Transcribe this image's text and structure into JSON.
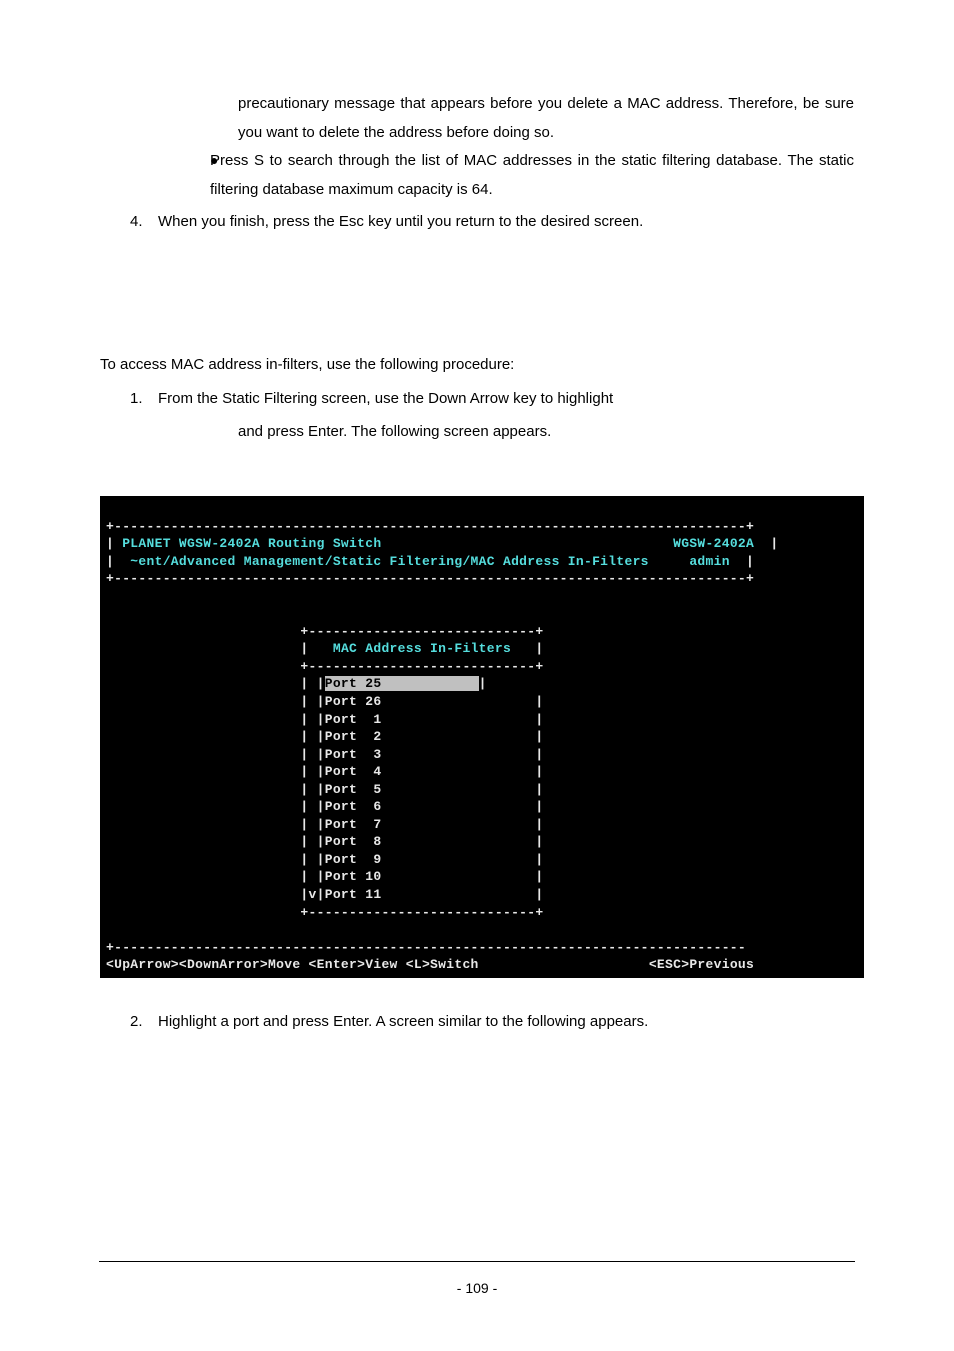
{
  "para_continue1": "precautionary message that appears before you delete a MAC address. Therefore, be sure you want to delete the address before doing so.",
  "bullet_s": "Press S to search through the list of MAC addresses in the static filtering database. The static filtering database maximum capacity is 64.",
  "step4_num": "4.",
  "step4_text": "When you finish, press the Esc key until you return to the desired screen.",
  "access_para": "To access MAC address in-filters, use the following procedure:",
  "step1_num": "1.",
  "step1_text": "From the Static Filtering screen, use the Down Arrow key to highlight ",
  "step1_cont": " and press Enter. The following screen appears.",
  "terminal": {
    "rule_top": "+------------------------------------------------------------------------------+",
    "title_line1_pre": "| ",
    "title_line1_left": "PLANET WGSW-2402A Routing Switch",
    "title_line1_gap": "                                    ",
    "title_line1_right": "WGSW-2402A",
    "title_line1_post": "  |",
    "title_line2_pre": "| ",
    "title_line2_left": " ~ent/Advanced Management/Static Filtering/MAC Address In-Filters",
    "title_line2_gap": "     ",
    "title_line2_right": "admin",
    "title_line2_post": "  |",
    "rule_mid": "+------------------------------------------------------------------------------+",
    "blank": "",
    "box_top": "                        +----------------------------+",
    "box_title_pre": "                        |   ",
    "box_title": "MAC Address In-Filters",
    "box_title_post": "   |",
    "box_sep": "                        +----------------------------+",
    "row_prefix": "                        | |",
    "row_suffix_pad": "                   |",
    "rows": [
      "Port 25",
      "Port 26",
      "Port  1",
      "Port  2",
      "Port  3",
      "Port  4",
      "Port  5",
      "Port  6",
      "Port  7",
      "Port  8",
      "Port  9",
      "Port 10"
    ],
    "row_scroll_pre": "                        |v|",
    "row_scroll": "Port 11",
    "box_bot": "                        +----------------------------+",
    "rule_bot": "+------------------------------------------------------------------------------",
    "help_left": "<UpArrow><DownArror>Move <Enter>View <L>Switch",
    "help_gap": "                     ",
    "help_right": "<ESC>Previous"
  },
  "step2_num": "2.",
  "step2_text": "Highlight a port and press Enter. A screen similar to the following appears.",
  "page_num": "- 109 -"
}
